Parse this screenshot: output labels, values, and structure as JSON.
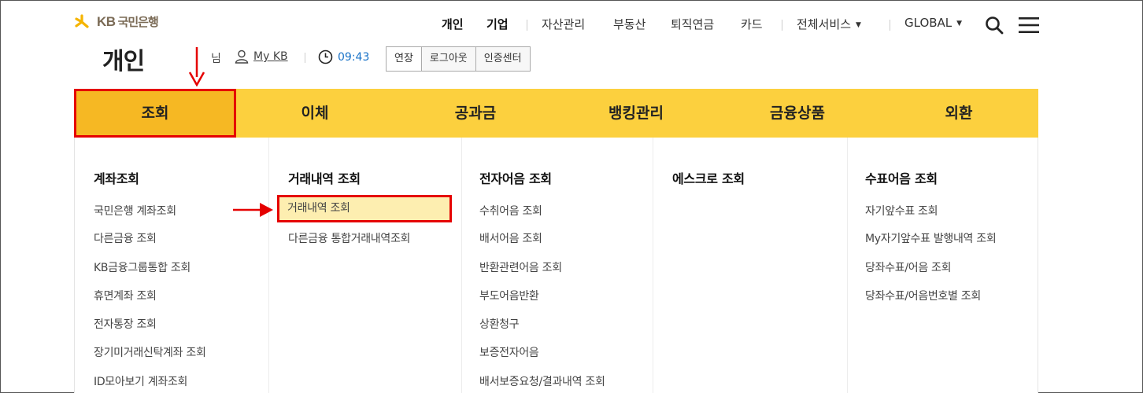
{
  "header": {
    "logo_kb": "KB",
    "logo_bank": "국민은행",
    "gnb": [
      {
        "label": "개인",
        "bold": true
      },
      {
        "label": "기업",
        "bold": true
      },
      {
        "label": "자산관리"
      },
      {
        "label": "부동산"
      },
      {
        "label": "퇴직연금"
      },
      {
        "label": "카드"
      },
      {
        "label": "전체서비스"
      },
      {
        "label": "GLOBAL"
      }
    ]
  },
  "sub": {
    "page_title": "개인",
    "user_suffix": "님",
    "mykb": "My KB",
    "time": "09:43",
    "buttons": [
      "연장",
      "로그아웃",
      "인증센터"
    ]
  },
  "nav": {
    "items": [
      "조회",
      "이체",
      "공과금",
      "뱅킹관리",
      "금융상품",
      "외환"
    ]
  },
  "menu": {
    "columns": [
      {
        "title": "계좌조회",
        "items": [
          "국민은행 계좌조회",
          "다른금융 조회",
          "KB금융그룹통합 조회",
          "휴면계좌 조회",
          "전자통장 조회",
          "장기미거래신탁계좌 조회",
          "ID모아보기 계좌조회"
        ]
      },
      {
        "title": "거래내역 조회",
        "items": [
          "거래내역 조회",
          "다른금융 통합거래내역조회"
        ]
      },
      {
        "title": "전자어음 조회",
        "items": [
          "수취어음 조회",
          "배서어음 조회",
          "반환관련어음 조회",
          "부도어음반환",
          "상환청구",
          "보증전자어음",
          "배서보증요청/결과내역 조회"
        ]
      },
      {
        "title": "에스크로 조회",
        "items": []
      },
      {
        "title": "수표어음 조회",
        "items": [
          "자기앞수표 조회",
          "My자기앞수표 발행내역 조회",
          "당좌수표/어음 조회",
          "당좌수표/어음번호별 조회"
        ]
      }
    ]
  },
  "colors": {
    "nav_bg": "#fcd03e",
    "nav_active": "#f6b823",
    "highlight_border": "#e50000",
    "highlight_bg": "#fdeeb0",
    "time_text": "#1a73c8"
  }
}
